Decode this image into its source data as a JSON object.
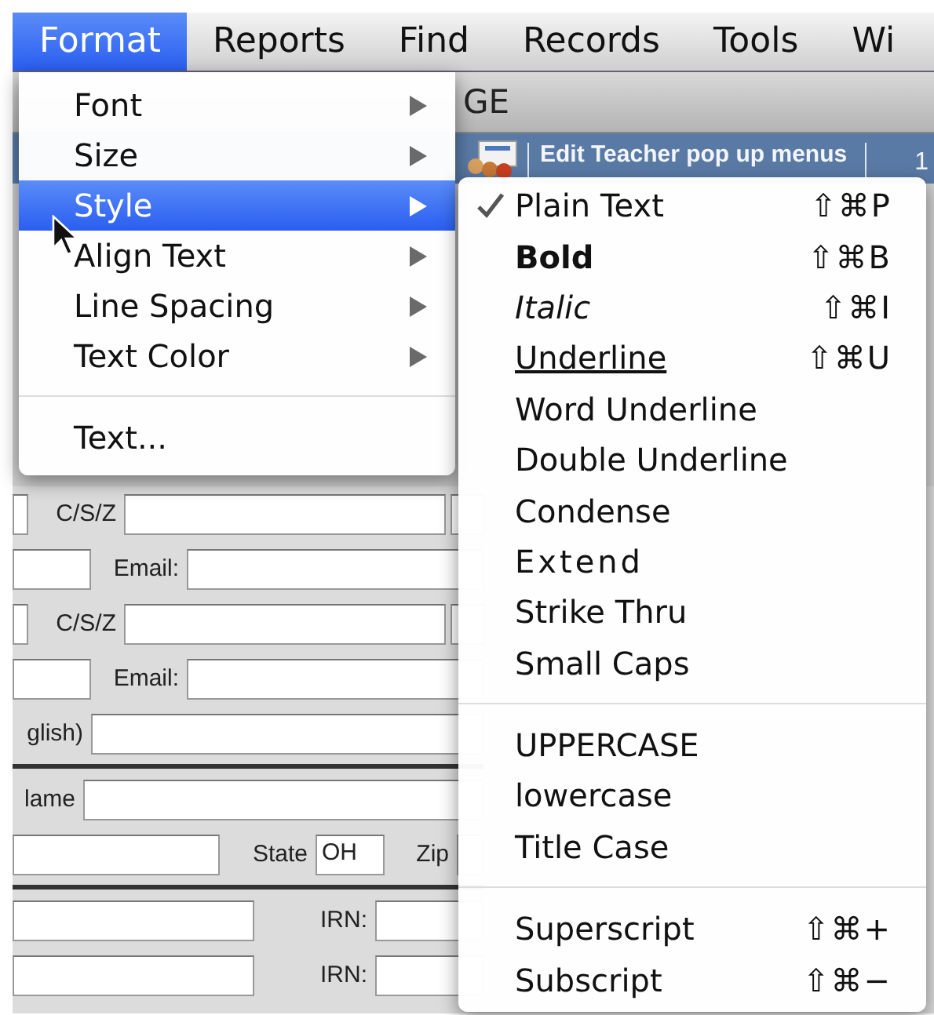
{
  "menu_bar": [
    {
      "label": "Format",
      "selected": true
    },
    {
      "label": "Reports",
      "selected": false
    },
    {
      "label": "Find",
      "selected": false
    },
    {
      "label": "Records",
      "selected": false
    },
    {
      "label": "Tools",
      "selected": false
    },
    {
      "label": "Wi",
      "selected": false
    }
  ],
  "window": {
    "title": "GE",
    "toolbar_text": "Edit Teacher pop up menus",
    "toolbar_extra": "1"
  },
  "form_rows": [
    {
      "kind": "csz",
      "cells": [
        {
          "kind": "field"
        },
        {
          "kind": "label",
          "text": "C/S/Z"
        },
        {
          "kind": "field"
        },
        {
          "kind": "field"
        }
      ]
    },
    {
      "kind": "email",
      "cells": [
        {
          "kind": "field"
        },
        {
          "kind": "label",
          "text": "Email:"
        },
        {
          "kind": "field"
        }
      ]
    },
    {
      "kind": "csz",
      "cells": [
        {
          "kind": "field"
        },
        {
          "kind": "label",
          "text": "C/S/Z"
        },
        {
          "kind": "field"
        },
        {
          "kind": "field"
        }
      ]
    },
    {
      "kind": "email",
      "cells": [
        {
          "kind": "field"
        },
        {
          "kind": "label",
          "text": "Email:"
        },
        {
          "kind": "field"
        }
      ]
    },
    {
      "kind": "text",
      "cells": [
        {
          "kind": "label",
          "text": "glish)"
        },
        {
          "kind": "field"
        }
      ]
    },
    {
      "kind": "rule"
    },
    {
      "kind": "name",
      "cells": [
        {
          "kind": "label",
          "text": "lame"
        },
        {
          "kind": "field"
        }
      ]
    },
    {
      "kind": "state",
      "cells": [
        {
          "kind": "field"
        },
        {
          "kind": "label",
          "text": "State"
        },
        {
          "kind": "field",
          "value": "OH"
        },
        {
          "kind": "label",
          "text": "Zip"
        },
        {
          "kind": "field"
        }
      ]
    },
    {
      "kind": "rule"
    },
    {
      "kind": "irn",
      "cells": [
        {
          "kind": "field"
        },
        {
          "kind": "label",
          "text": "IRN:"
        },
        {
          "kind": "field"
        }
      ]
    },
    {
      "kind": "irn",
      "cells": [
        {
          "kind": "field"
        },
        {
          "kind": "label",
          "text": "IRN:"
        },
        {
          "kind": "field"
        }
      ]
    }
  ],
  "format_menu": {
    "groups": [
      [
        {
          "label": "Font",
          "submenu": true,
          "selected": false
        },
        {
          "label": "Size",
          "submenu": true,
          "selected": false
        },
        {
          "label": "Style",
          "submenu": true,
          "selected": true
        },
        {
          "label": "Align Text",
          "submenu": true,
          "selected": false
        },
        {
          "label": "Line Spacing",
          "submenu": true,
          "selected": false
        },
        {
          "label": "Text Color",
          "submenu": true,
          "selected": false
        }
      ],
      [
        {
          "label": "Text...",
          "submenu": false,
          "selected": false
        }
      ]
    ]
  },
  "style_menu": {
    "groups": [
      [
        {
          "label": "Plain Text",
          "kind": "plain",
          "checked": true,
          "shortcut": "⇧⌘P"
        },
        {
          "label": "Bold",
          "kind": "bold",
          "checked": false,
          "shortcut": "⇧⌘B"
        },
        {
          "label": "Italic",
          "kind": "italic",
          "checked": false,
          "shortcut": "⇧⌘I"
        },
        {
          "label": "Underline",
          "kind": "underline",
          "checked": false,
          "shortcut": "⇧⌘U"
        },
        {
          "label": "Word Underline",
          "kind": "plain",
          "checked": false
        },
        {
          "label": "Double Underline",
          "kind": "plain",
          "checked": false
        },
        {
          "label": "Condense",
          "kind": "plain",
          "checked": false
        },
        {
          "label": "Extend",
          "kind": "extend",
          "checked": false
        },
        {
          "label": "Strike Thru",
          "kind": "plain",
          "checked": false
        },
        {
          "label": "Small Caps",
          "kind": "plain",
          "checked": false
        }
      ],
      [
        {
          "label": "UPPERCASE",
          "kind": "plain",
          "checked": false
        },
        {
          "label": "lowercase",
          "kind": "plain",
          "checked": false
        },
        {
          "label": "Title Case",
          "kind": "plain",
          "checked": false
        }
      ],
      [
        {
          "label": "Superscript",
          "kind": "plain",
          "checked": false,
          "shortcut": "⇧⌘+"
        },
        {
          "label": "Subscript",
          "kind": "plain",
          "checked": false,
          "shortcut": "⇧⌘−"
        }
      ]
    ]
  }
}
